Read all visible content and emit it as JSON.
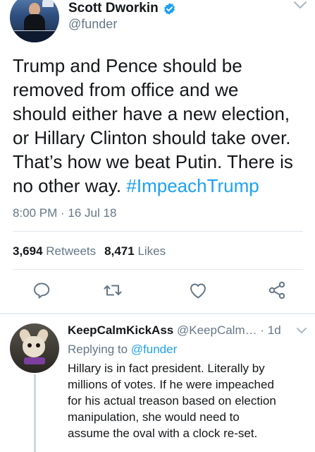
{
  "tweet": {
    "author": {
      "display_name": "Scott Dworkin",
      "handle": "@funder",
      "verified": true
    },
    "text": "Trump and Pence should be\nremoved from office and we\nshould either have a new election,\nor Hillary Clinton should take over.\nThat’s how we beat Putin. There is\nno other way. ",
    "hashtag": "#ImpeachTrump",
    "timestamp": "8:00 PM · 16 Jul 18",
    "stats": {
      "retweets_count": "3,694",
      "retweets_label": "Retweets",
      "likes_count": "8,471",
      "likes_label": "Likes"
    },
    "actions": [
      "reply-icon",
      "retweet-icon",
      "like-icon",
      "share-icon"
    ]
  },
  "reply": {
    "display_name": "KeepCalmKickAss",
    "handle": "@KeepCalm…",
    "time": "· 1d",
    "replying_prefix": "Replying to",
    "replying_to": "@funder",
    "text": "Hillary is in fact president. Literally by\nmillions of votes. If he were impeached\nfor his actual treason based on election\nmanipulation, she would need to\nassume the oval with a clock re-set."
  },
  "colors": {
    "accent": "#1da1f2",
    "secondary_text": "#657786",
    "primary_text": "#14171a",
    "divider": "#e1e8ed"
  }
}
